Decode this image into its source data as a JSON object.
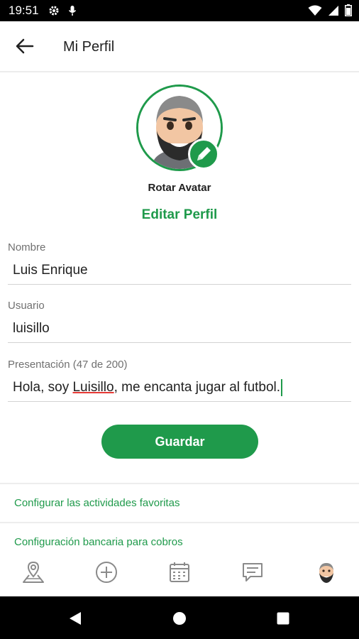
{
  "status_bar": {
    "time": "19:51"
  },
  "app_bar": {
    "title": "Mi Perfil"
  },
  "profile": {
    "rotate_avatar_label": "Rotar Avatar",
    "edit_profile_title": "Editar Perfil"
  },
  "form": {
    "name_label": "Nombre",
    "name_value": "Luis Enrique",
    "username_label": "Usuario",
    "username_value": "luisillo",
    "bio_label": "Presentación (47 de 200)",
    "bio_before": "Hola, soy ",
    "bio_misspelled": "Luisillo",
    "bio_after": ", me encanta jugar al futbol."
  },
  "save_button": "Guardar",
  "links": {
    "favorite_activities": "Configurar las actividades favoritas",
    "bank_settings": "Configuración bancaria para cobros"
  },
  "bottom_nav": [
    "map-location-icon",
    "add-circle-icon",
    "calendar-icon",
    "chat-icon",
    "avatar-icon"
  ],
  "colors": {
    "accent": "#1f9a4b",
    "text": "#212121",
    "label": "#707070"
  }
}
